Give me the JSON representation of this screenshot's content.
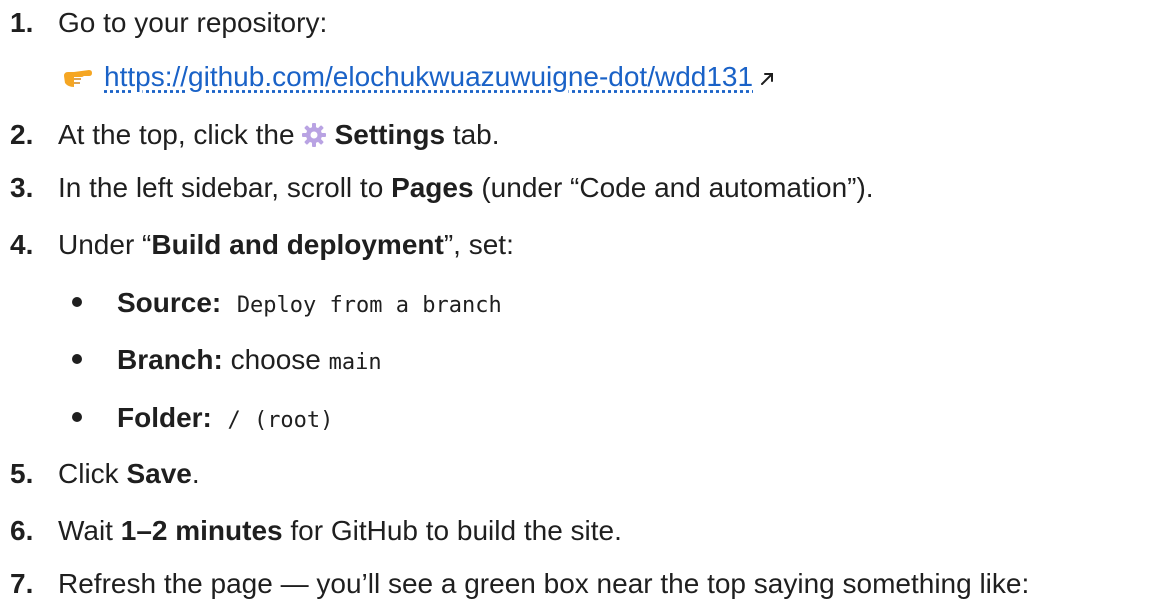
{
  "steps": [
    {
      "num": "1.",
      "text": "Go to your repository:"
    },
    {
      "num": "2.",
      "pre": "At the top, click the",
      "bold": "Settings",
      "post": "tab."
    },
    {
      "num": "3.",
      "pre": "In the left sidebar, scroll to",
      "bold": "Pages",
      "post": "(under “Code and automation”)."
    },
    {
      "num": "4.",
      "pre": "Under “",
      "bold": "Build and deployment",
      "post": "”, set:"
    },
    {
      "num": "5.",
      "pre": "Click",
      "bold": "Save",
      "post": "."
    },
    {
      "num": "6.",
      "pre": "Wait",
      "bold": "1–2 minutes",
      "post": "for GitHub to build the site."
    },
    {
      "num": "7.",
      "text": "Refresh the page — you’ll see a green box near the top saying something like:"
    }
  ],
  "repo_link": "https://github.com/elochukwuazuwuigne-dot/wdd131",
  "settings_bullets": [
    {
      "label": "Source:",
      "plain": "",
      "code": "Deploy from a branch"
    },
    {
      "label": "Branch:",
      "plain": "choose",
      "code": "main"
    },
    {
      "label": "Folder:",
      "plain": "",
      "code": "/ (root)"
    }
  ],
  "icons": {
    "pointer": "pointing-hand-icon",
    "gear": "gear-icon",
    "external": "external-link-icon"
  },
  "colors": {
    "link": "#1a62c7",
    "text": "#1f1f1f",
    "hand": "#f5a623",
    "gear": "#b9a3e3"
  }
}
